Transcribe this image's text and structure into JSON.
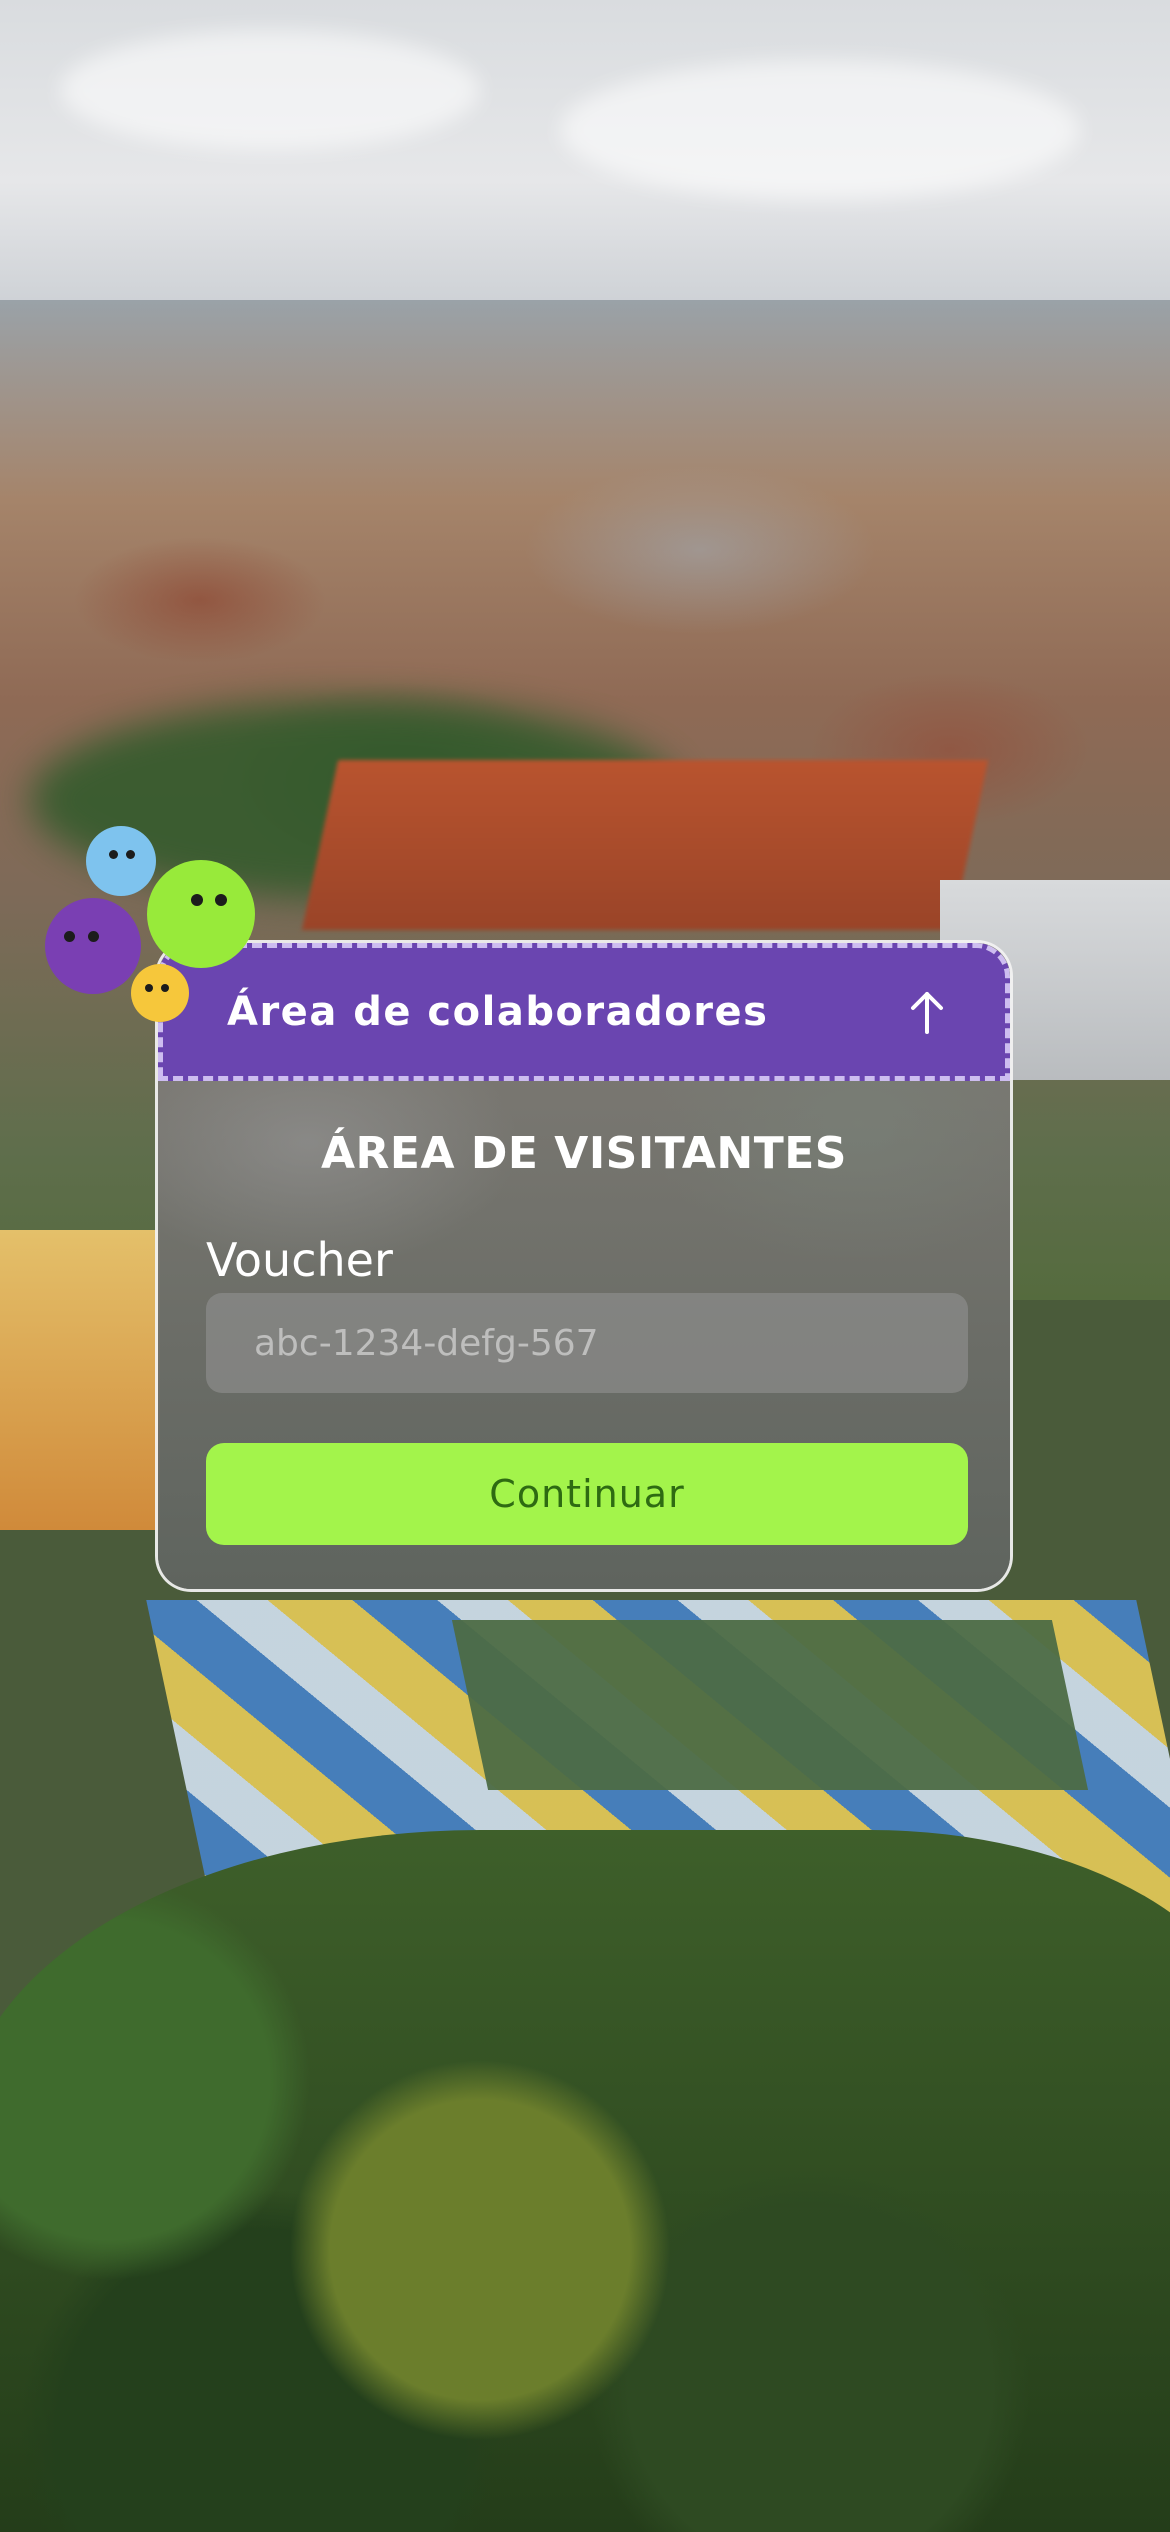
{
  "colors": {
    "collab_bar": "#6a45b0",
    "continue_button": "#a3f44b",
    "continue_text": "#2e6b12",
    "mascot_blue": "#7ec3ee",
    "mascot_green": "#98ea3a",
    "mascot_purple": "#7a3fb3",
    "mascot_yellow": "#f6c73b"
  },
  "collaborators": {
    "label": "Área de colaboradores",
    "icon": "arrow-up-icon"
  },
  "visitors": {
    "title": "ÁREA DE VISITANTES",
    "voucher_label": "Voucher",
    "voucher_value": "",
    "voucher_placeholder": "abc-1234-defg-567",
    "continue_label": "Continuar"
  }
}
